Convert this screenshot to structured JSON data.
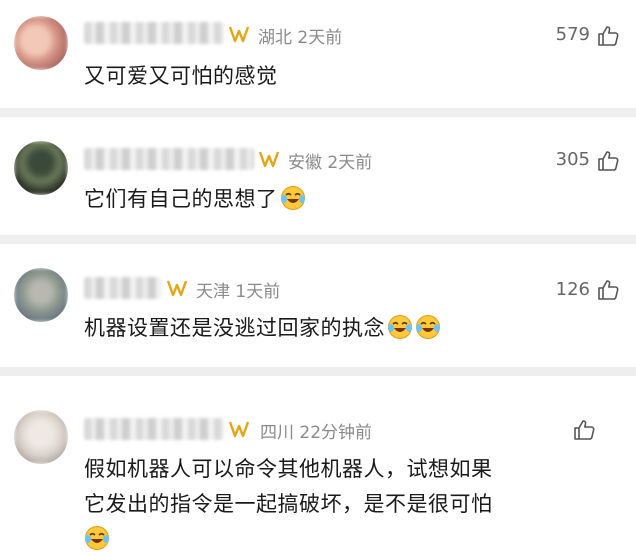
{
  "comments": [
    {
      "location": "湖北",
      "time": "2天前",
      "likes": "579",
      "text": "又可爱又可怕的感觉",
      "emoji_count": 0
    },
    {
      "location": "安徽",
      "time": "2天前",
      "likes": "305",
      "text": "它们有自己的思想了",
      "emoji_count": 1
    },
    {
      "location": "天津",
      "time": "1天前",
      "likes": "126",
      "text": "机器设置还是没逃过回家的执念",
      "emoji_count": 2
    },
    {
      "location": "四川",
      "time": "22分钟前",
      "likes": "",
      "text_line1": "假如机器人可以命令其他机器人，试想如果",
      "text_line2": "它发出的指令是一起搞破坏，是不是很可怕",
      "emoji_count": 1
    }
  ],
  "icons": {
    "vip": "vip-badge-icon",
    "like": "thumbs-up-icon",
    "emoji": "laughing-crying-emoji-icon"
  },
  "colors": {
    "vip_gold": "#e6a417",
    "meta_gray": "#8a8a8a",
    "separator": "#eeeeee"
  }
}
